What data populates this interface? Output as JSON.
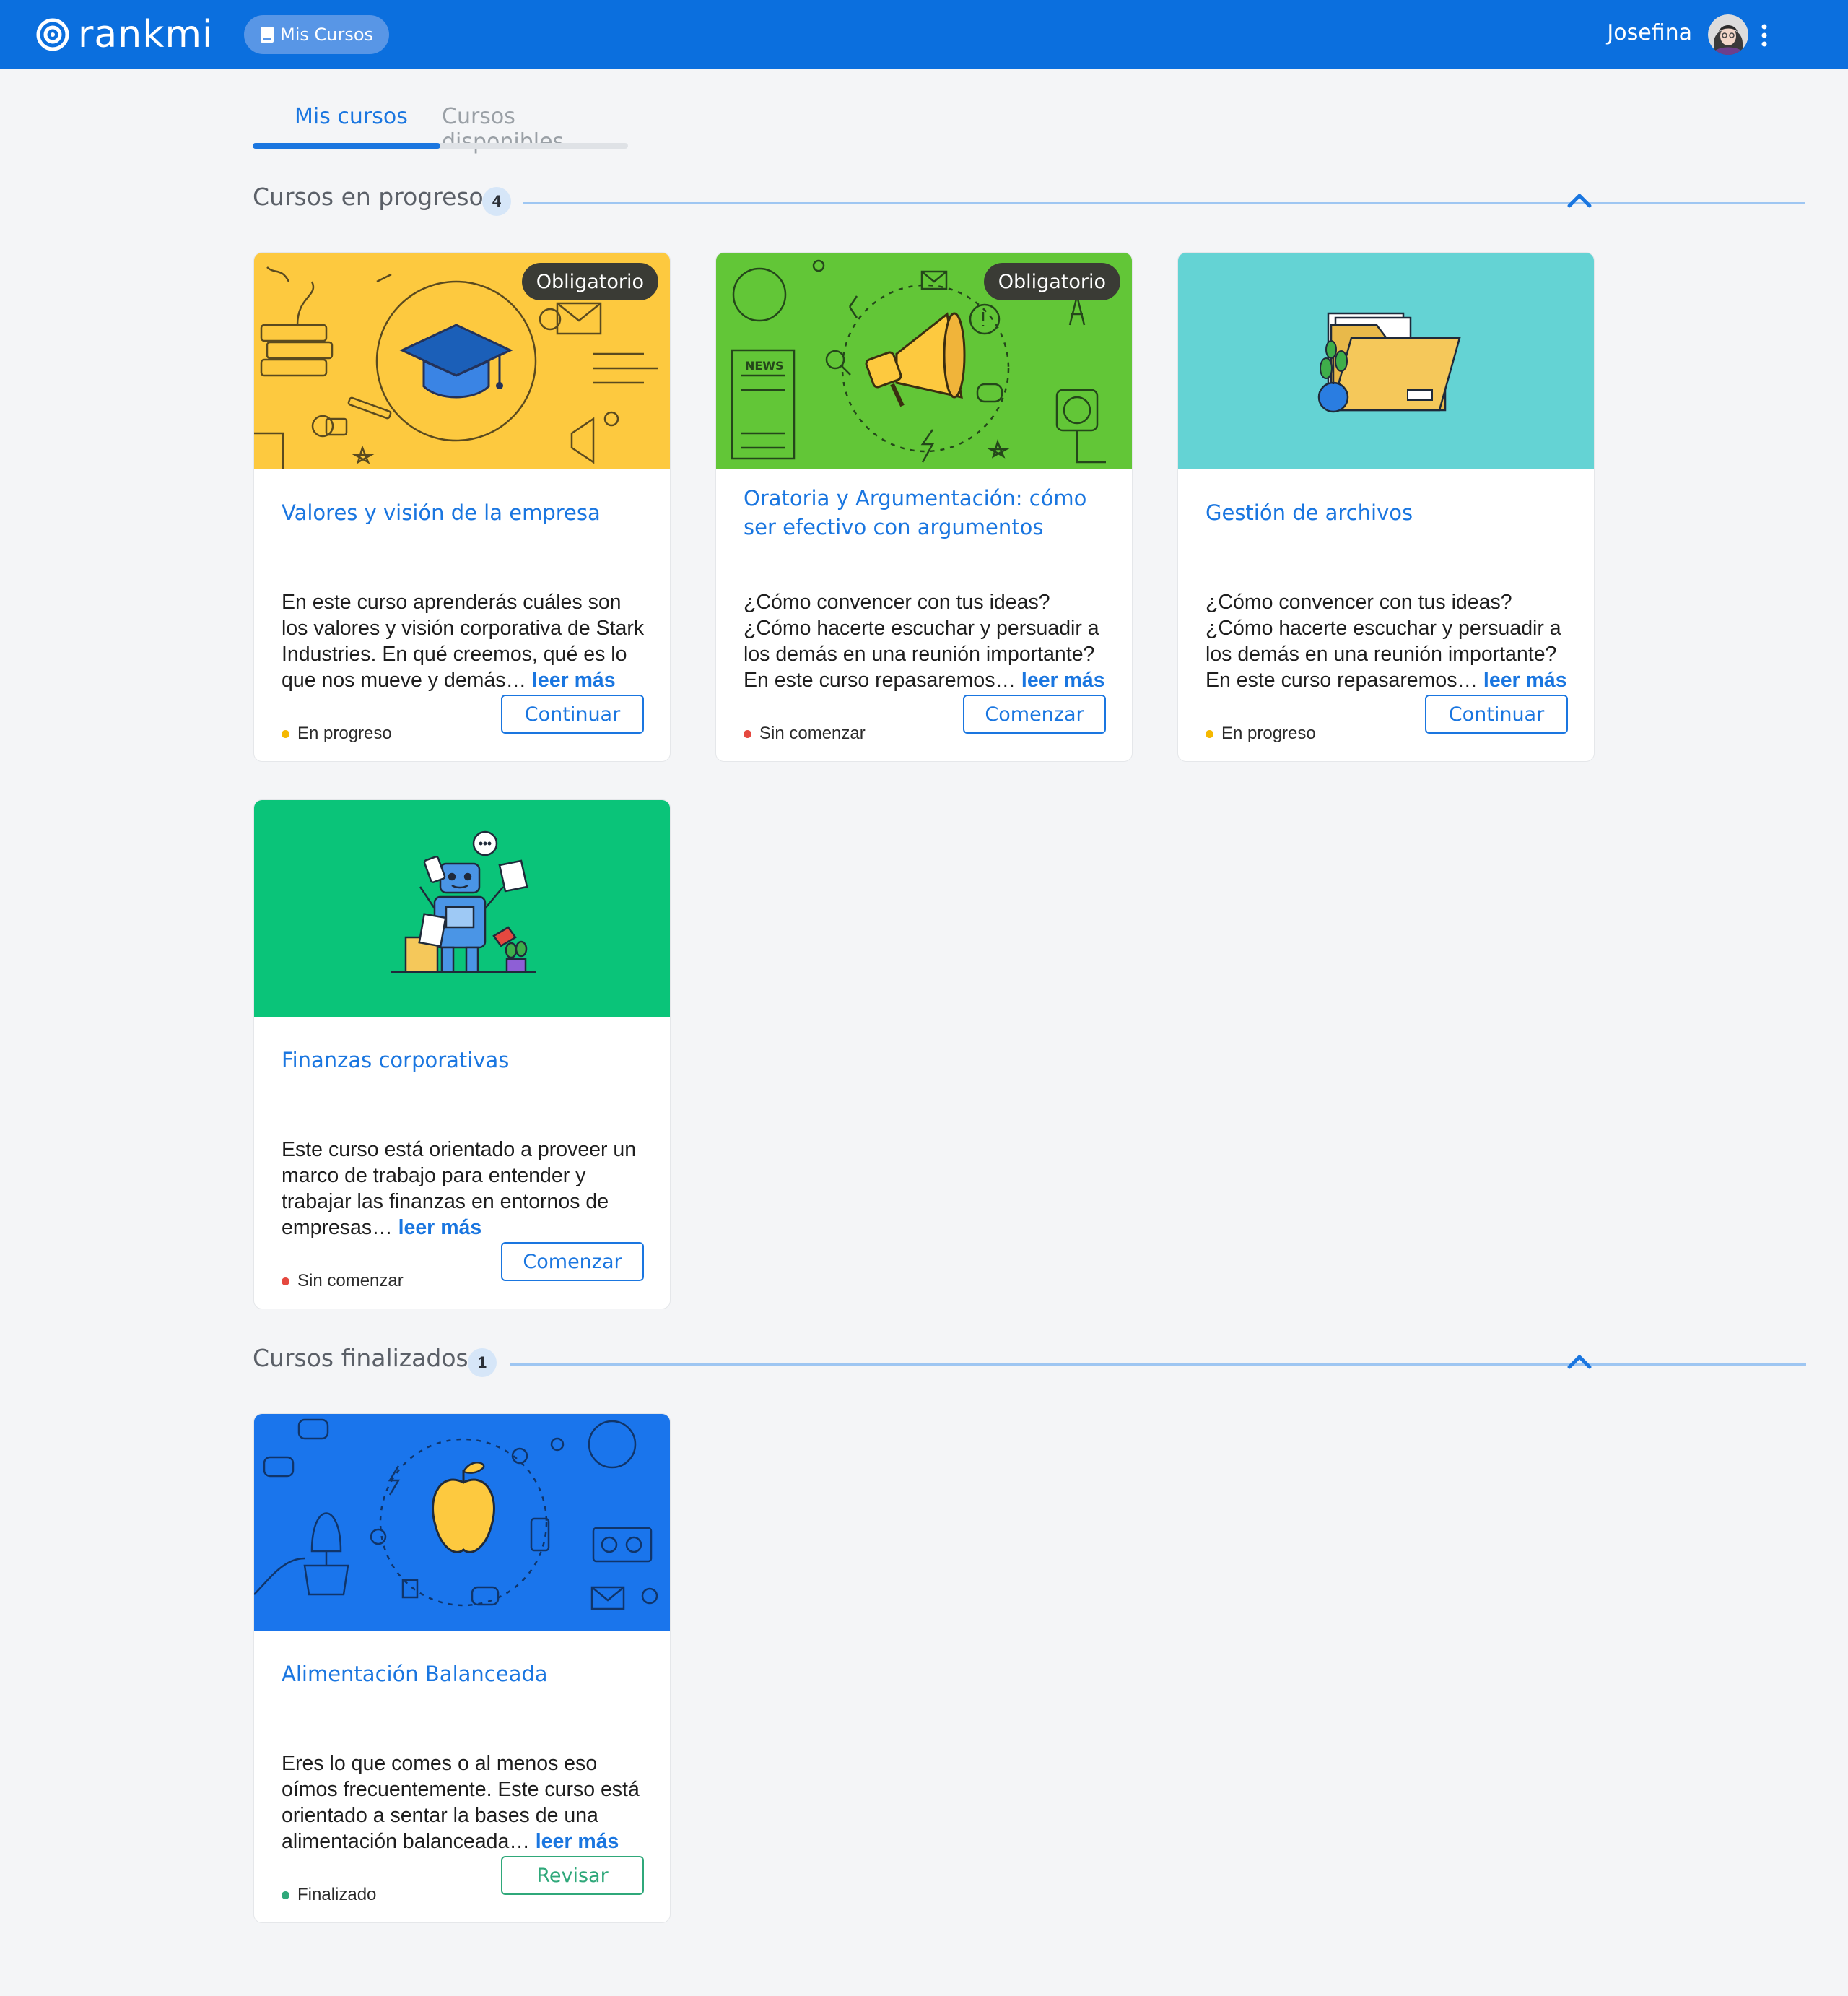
{
  "header": {
    "brand": "rankmi",
    "nav_pill": "Mis Cursos",
    "user_name": "Josefina",
    "icons": {
      "logo": "rankmi-logo-icon",
      "nav": "book-icon",
      "avatar": "user-avatar",
      "menu": "kebab-menu-icon"
    }
  },
  "tabs": [
    {
      "label": "Mis cursos",
      "active": true
    },
    {
      "label": "Cursos disponibles",
      "active": false
    }
  ],
  "sections": {
    "in_progress": {
      "title": "Cursos en progreso",
      "count": "4",
      "collapse_icon": "chevron-up-icon"
    },
    "finished": {
      "title": "Cursos finalizados",
      "count": "1",
      "collapse_icon": "chevron-up-icon"
    }
  },
  "read_more": "leer más",
  "ellipsis": "…",
  "colors": {
    "primary": "#0b6fde",
    "link": "#1a76e0",
    "status_in_progress": "#f5b800",
    "status_not_started": "#e5483f",
    "status_finished": "#2fa87a"
  },
  "courses": [
    {
      "title": "Valores y visión de la empresa",
      "badge": "Obligatorio",
      "description": "En este curso aprenderás cuáles son los valores y visión corporativa de Stark Industries. En qué creemos, qué es lo que nos mueve y demás",
      "status": "En progreso",
      "button": "Continuar",
      "image_color": "#fdc93f",
      "image_icon": "graduation-cap-icon"
    },
    {
      "title": "Oratoria y Argumentación: cómo ser efectivo con argumentos",
      "badge": "Obligatorio",
      "description": "¿Cómo convencer con tus ideas? ¿Cómo hacerte escuchar y persuadir a los demás en una reunión importante? En este curso repasaremos",
      "status": "Sin comenzar",
      "button": "Comenzar",
      "image_color": "#62c637",
      "image_icon": "megaphone-icon"
    },
    {
      "title": "Gestión de archivos",
      "badge": "",
      "description": "¿Cómo convencer con tus ideas? ¿Cómo hacerte escuchar y persuadir a los demás en una reunión importante? En este curso repasaremos",
      "status": "En progreso",
      "button": "Continuar",
      "image_color": "#64d3d4",
      "image_icon": "folder-icon"
    },
    {
      "title": "Finanzas corporativas",
      "badge": "",
      "description": "Este curso está orientado a proveer un marco de trabajo para entender y trabajar las finanzas en entornos de empresas",
      "status": "Sin comenzar",
      "button": "Comenzar",
      "image_color": "#0ac479",
      "image_icon": "robot-icon"
    },
    {
      "title": "Alimentación Balanceada",
      "badge": "",
      "description": "Eres lo que comes o al menos eso oímos frecuentemente. Este curso está orientado a sentar la bases de una alimentación balanceada",
      "status": "Finalizado",
      "button": "Revisar",
      "image_color": "#1a75ec",
      "image_icon": "apple-icon"
    }
  ]
}
